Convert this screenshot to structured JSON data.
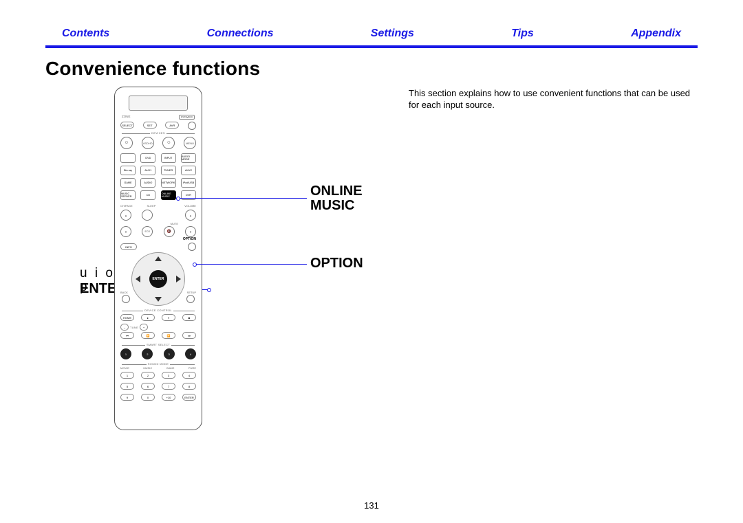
{
  "nav": {
    "contents": "Contents",
    "connections": "Connections",
    "settings": "Settings",
    "tips": "Tips",
    "appendix": "Appendix"
  },
  "heading": "Convenience functions",
  "description": "This section explains how to use convenient functions that can be used for each input source.",
  "callouts": {
    "uiop": "u  i  o  p",
    "enter": "ENTER",
    "online_music_1": "ONLINE",
    "online_music_2": "MUSIC",
    "option": "OPTION"
  },
  "remote": {
    "zone_label": "ZONE",
    "power_label": "POWER",
    "row1": [
      "SELECT",
      "SET",
      "AVR",
      ""
    ],
    "row2": [
      "",
      "VSDHD",
      "",
      "MENU"
    ],
    "devices_label": "DEVICES",
    "src": [
      [
        "",
        "DVD",
        "INPUT",
        "AUDIO MODE"
      ],
      [
        "Blu-ray",
        "AUX1",
        "TUNER",
        "AUX2"
      ],
      [
        "GAME",
        "AUDIO",
        "NETWORK",
        "iPod/USB"
      ],
      [
        "MUSIC SERVER",
        "CD",
        "ONLINE MUSIC",
        "DVR"
      ]
    ],
    "chpage": "CH/PAGE",
    "sleep": "SLEEP",
    "volume": "VOLUME",
    "mute": "MUTE",
    "info": "INFO",
    "option": "OPTION",
    "back": "BACK",
    "setup": "SETUP",
    "enter": "ENTER",
    "device_control": "DEVICE CONTROL",
    "home": "HOME",
    "tune_minus": "–",
    "tune_label": "TUNE",
    "tune_plus": "+",
    "smart_select": "SMART SELECT",
    "smart": [
      "1",
      "2",
      "3",
      "4"
    ],
    "sound_mode": "SOUND MODE",
    "modes": [
      "MOVIE",
      "MUSIC",
      "GAME",
      "PURE"
    ],
    "nums": [
      "1",
      "2",
      "3",
      "4",
      "5",
      "6",
      "7",
      "8",
      "9",
      "0",
      "+10",
      "ENTER"
    ]
  },
  "page_number": "131"
}
